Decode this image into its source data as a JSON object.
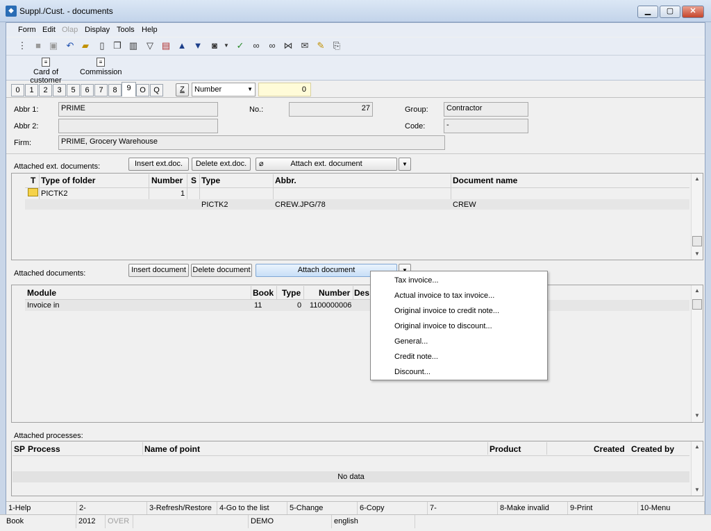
{
  "window": {
    "title": "Suppl./Cust. - documents",
    "min": "▁",
    "max": "▢",
    "close": "✕"
  },
  "menu": [
    "Form",
    "Edit",
    "Olap",
    "Display",
    "Tools",
    "Help"
  ],
  "commands": [
    {
      "label": "Card of customer"
    },
    {
      "label": "Commission"
    }
  ],
  "tabs": [
    "0",
    "1",
    "2",
    "3",
    "5",
    "6",
    "7",
    "8",
    "9",
    "O",
    "Q"
  ],
  "search": {
    "z_label": "Z",
    "field": "Number",
    "value": "0"
  },
  "header": {
    "abbr1_label": "Abbr 1:",
    "abbr1": "PRIME",
    "abbr2_label": "Abbr 2:",
    "abbr2": "",
    "firm_label": "Firm:",
    "firm": "PRIME, Grocery Warehouse",
    "no_label": "No.:",
    "no": "27",
    "group_label": "Group:",
    "group": "Contractor",
    "code_label": "Code:",
    "code": "-"
  },
  "ext_docs": {
    "label": "Attached ext. documents:",
    "insert": "Insert ext.doc.",
    "delete": "Delete ext.doc.",
    "attach": "Attach ext. document",
    "columns": {
      "t": "T",
      "type_of_folder": "Type of folder",
      "number": "Number",
      "s": "S",
      "type": "Type",
      "abbr": "Abbr.",
      "document_name": "Document name"
    },
    "rows": [
      {
        "folder": "PICTK2",
        "number": "1",
        "type": "",
        "abbr": "",
        "name": ""
      },
      {
        "folder": "",
        "number": "",
        "type": "PICTK2",
        "abbr": "CREW.JPG/78",
        "name": "CREW"
      }
    ]
  },
  "docs": {
    "label": "Attached documents:",
    "insert": "Insert document",
    "delete": "Delete document",
    "attach": "Attach document",
    "columns": {
      "module": "Module",
      "book": "Book",
      "type": "Type",
      "number": "Number",
      "des": "Des"
    },
    "rows": [
      {
        "module": "Invoice in",
        "book": "11",
        "type": "0",
        "number": "1100000006"
      }
    ]
  },
  "popup_menu": [
    "Tax invoice...",
    "Actual invoice to tax invoice...",
    "Original invoice to credit note...",
    "Original invoice to discount...",
    "General...",
    "Credit note...",
    "Discount..."
  ],
  "processes": {
    "label": "Attached processes:",
    "columns": {
      "sp": "SP",
      "process": "Process",
      "name_of_point": "Name of point",
      "product": "Product",
      "created": "Created",
      "created_by": "Created by"
    },
    "empty": "No data"
  },
  "fkeys": [
    "1-Help",
    "2-",
    "3-Refresh/Restore",
    "4-Go to the list",
    "5-Change",
    "6-Copy",
    "7-",
    "8-Make invalid",
    "9-Print",
    "10-Menu"
  ],
  "status": {
    "module": "Book",
    "year": "2012",
    "over": "OVER",
    "company": "DEMO",
    "language": "english"
  }
}
